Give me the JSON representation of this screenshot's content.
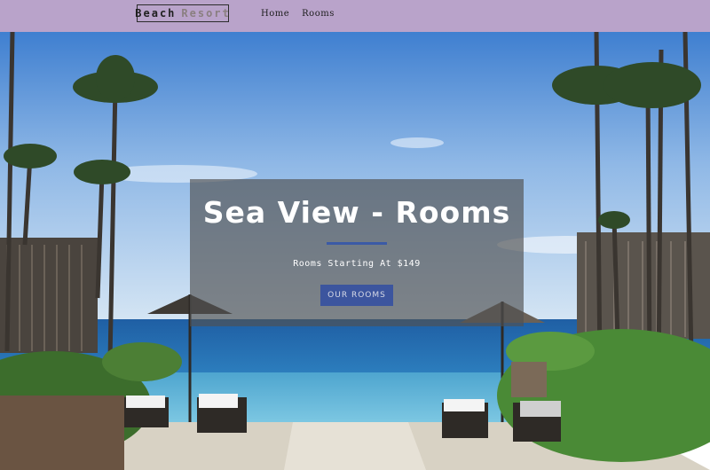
{
  "nav": {
    "logo_part1": "Beach",
    "logo_part2": "Resort",
    "links": [
      "Home",
      "Rooms"
    ]
  },
  "hero": {
    "title": "Sea View - Rooms",
    "subtitle": "Rooms Starting At $149",
    "button_label": "OUR ROOMS"
  },
  "colors": {
    "navbar": "#b9a3ca",
    "accent": "#3b5aa6",
    "button": "#3c559e"
  }
}
